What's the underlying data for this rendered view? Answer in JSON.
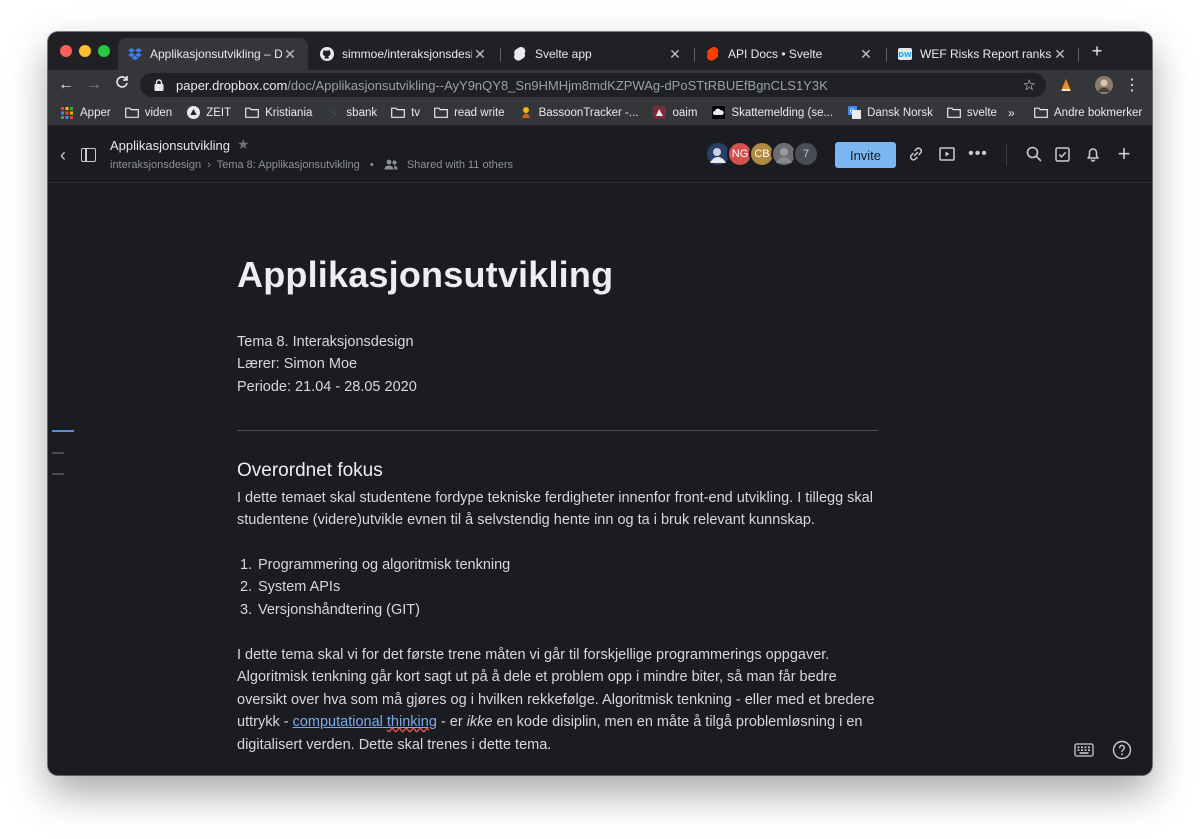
{
  "browser": {
    "tabs": [
      {
        "title": "Applikasjonsutvikling – Drop",
        "favicon": "dropbox-icon",
        "active": true
      },
      {
        "title": "simmoe/interaksjonsdesign-",
        "favicon": "github-icon",
        "active": false
      },
      {
        "title": "Svelte app",
        "favicon": "svelte-icon",
        "active": false
      },
      {
        "title": "API Docs • Svelte",
        "favicon": "svelte-icon",
        "active": false
      },
      {
        "title": "WEF Risks Report ranks clin",
        "favicon": "dw-icon",
        "active": false
      }
    ],
    "url_host": "paper.dropbox.com",
    "url_path": "/doc/Applikasjonsutvikling--AyY9nQY8_Sn9HMHjm8mdKZPWAg-dPoSTtRBUEfBgnCLS1Y3K",
    "bookmarks": [
      {
        "label": "Apper",
        "icon": "apps-grid-icon"
      },
      {
        "label": "viden",
        "icon": "folder-icon"
      },
      {
        "label": "ZEIT",
        "icon": "zeit-icon"
      },
      {
        "label": "Kristiania",
        "icon": "folder-icon"
      },
      {
        "label": "sbank",
        "icon": "sbank-icon"
      },
      {
        "label": "tv",
        "icon": "folder-icon"
      },
      {
        "label": "read write",
        "icon": "folder-icon"
      },
      {
        "label": "BassoonTracker -...",
        "icon": "bassoon-icon"
      },
      {
        "label": "oaim",
        "icon": "oaim-icon"
      },
      {
        "label": "Skattemelding (se...",
        "icon": "cloud-icon"
      },
      {
        "label": "Dansk Norsk",
        "icon": "translate-icon"
      },
      {
        "label": "svelte",
        "icon": "folder-icon"
      }
    ],
    "bookmarks_more": "»",
    "other_bookmarks": "Andre bokmerker"
  },
  "paper": {
    "doc_title": "Applikasjonsutvikling",
    "breadcrumb_folder": "interaksjonsdesign",
    "breadcrumb_separator": "›",
    "breadcrumb_doc": "Tema 8: Applikasjonsutvikling",
    "shared_text": "Shared with 11 others",
    "avatars": [
      {
        "initials": "",
        "color": "#2a3f66"
      },
      {
        "initials": "NG",
        "color": "#d4504c"
      },
      {
        "initials": "CB",
        "color": "#b08a3e"
      },
      {
        "initials": "",
        "color": "#6b6d70"
      },
      {
        "initials": "7",
        "color": "#4a4d55"
      }
    ],
    "invite_label": "Invite"
  },
  "document": {
    "title": "Applikasjonsutvikling",
    "meta_lines": [
      "Tema 8. Interaksjonsdesign",
      "Lærer: Simon Moe",
      "Periode: 21.04 - 28.05 2020"
    ],
    "section_heading": "Overordnet fokus",
    "intro": "I dette temaet skal studentene fordype tekniske ferdigheter innenfor front-end utvikling. I tillegg skal studentene (videre)utvikle evnen til å selvstendig hente inn og ta i bruk relevant kunnskap.",
    "list": [
      {
        "num": "1.",
        "text": "Programmering og algoritmisk tenkning"
      },
      {
        "num": "2.",
        "text": "System APIs"
      },
      {
        "num": "3.",
        "text": "Versjonshåndtering (GIT)"
      }
    ],
    "para2_a": "I dette tema skal vi for det første trene måten vi går til forskjellige programmerings oppgaver. Algoritmisk tenkning går kort sagt ut på å dele et problem opp i mindre biter, så man får bedre oversikt over hva som må gjøres og i hvilken rekkefølge. Algoritmisk tenkning - eller med et bredere uttrykk - ",
    "para2_link_1": "computational",
    "para2_link_space": " ",
    "para2_link_2": "thinking",
    "para2_b": " - er ",
    "para2_em": "ikke",
    "para2_c": " en kode disiplin, men en måte å tilgå problemløsning i en digitalisert verden. Dette skal trenes i dette tema."
  }
}
